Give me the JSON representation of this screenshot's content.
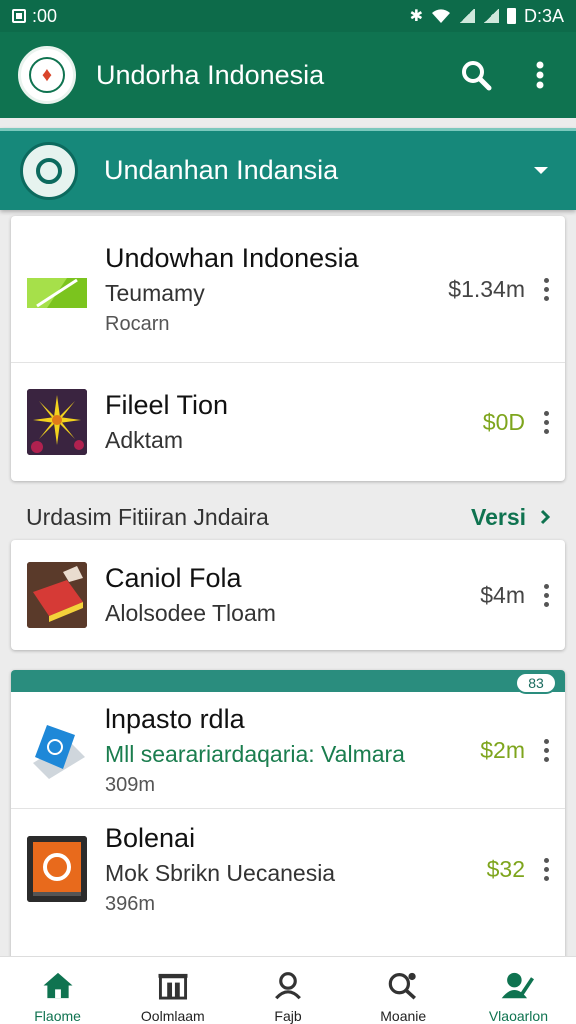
{
  "status_bar": {
    "time_left": ":00",
    "time_right": "D:3A"
  },
  "app_bar": {
    "title": "Undorha Indonesia"
  },
  "section": {
    "title": "Undanhan Indansia"
  },
  "group1": [
    {
      "name": "Undowhan Indonesia",
      "sub": "Teumamy",
      "sub2": "Rocarn",
      "price": "$1.34m",
      "price_color": "#444444",
      "thumb": "green-flag"
    },
    {
      "name": "Fileel Tion",
      "sub": "Adktam",
      "sub2": "",
      "price": "$0D",
      "price_color": "#7ea51d",
      "thumb": "flower"
    }
  ],
  "subheader": {
    "title": "Urdasim Fitiiran Jndaira",
    "link": "Versi"
  },
  "group2": [
    {
      "name": "Caniol Fola",
      "sub": "Alolsodee Tloam",
      "price": "$4m",
      "thumb": "book"
    }
  ],
  "group3_badge": "83",
  "group3": [
    {
      "name": "lnpasto rdla",
      "sub": "Mll searariardaqaria: Valmara",
      "sub2": "309m",
      "price": "$2m",
      "thumb": "tablet-blue"
    },
    {
      "name": "Bolenai",
      "sub": "Mok Sbrikn Uecanesia",
      "sub2": "396m",
      "price": "$32",
      "thumb": "tablet-orange"
    }
  ],
  "bottom_nav": [
    {
      "label": "Flaome",
      "icon": "home-icon",
      "active": true
    },
    {
      "label": "Oolmlaam",
      "icon": "store-icon",
      "active": false
    },
    {
      "label": "Fajb",
      "icon": "profile-icon",
      "active": false
    },
    {
      "label": "Moanie",
      "icon": "search-people-icon",
      "active": false
    },
    {
      "label": "Vlaoarlon",
      "icon": "user-edit-icon",
      "active": true
    }
  ],
  "colors": {
    "primary": "#0f7350",
    "teal": "#16887a",
    "price_green": "#7ea51d"
  }
}
